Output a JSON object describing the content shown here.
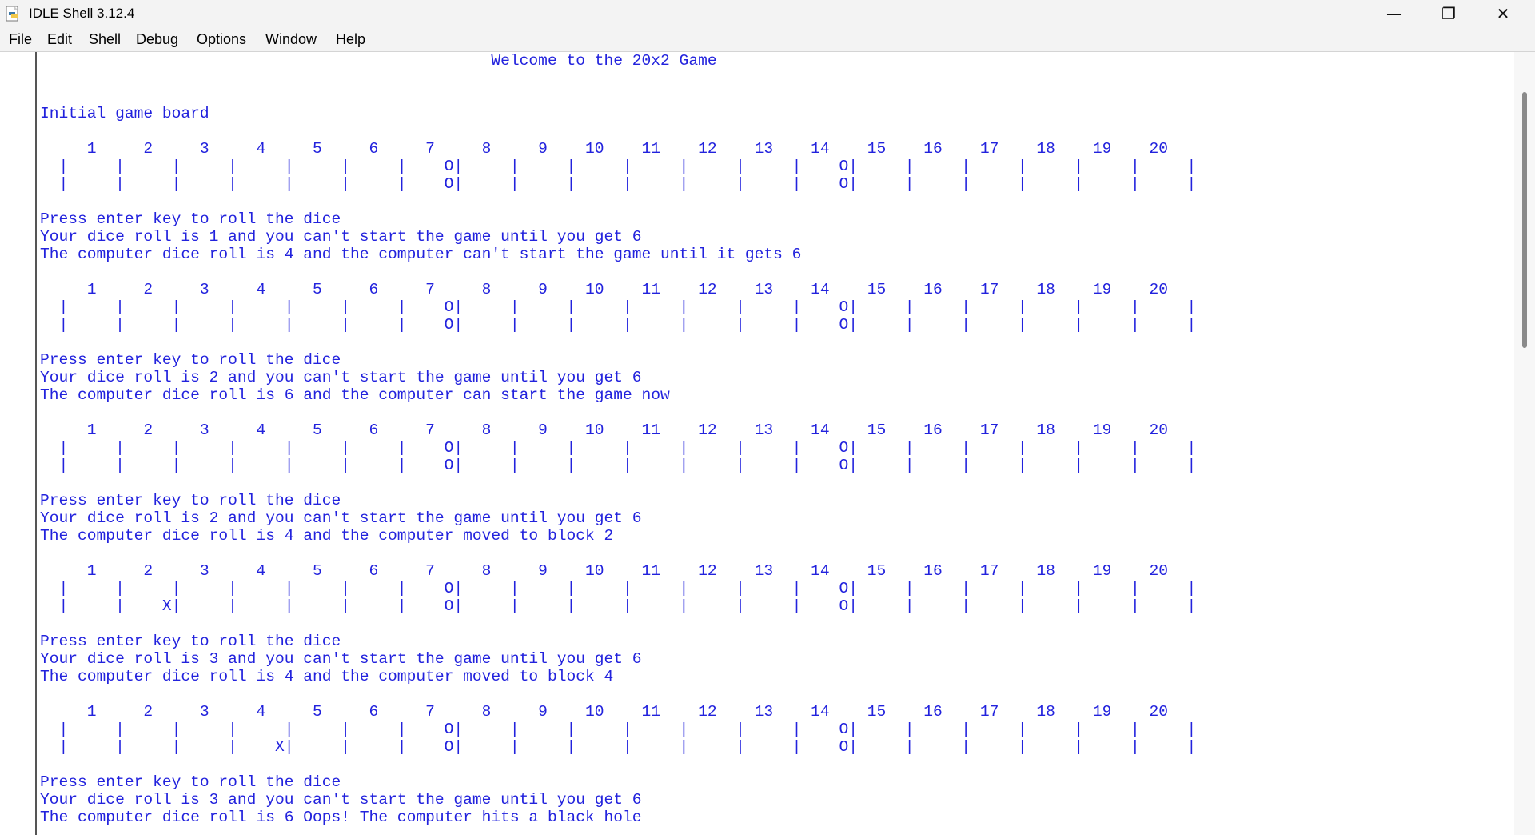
{
  "window": {
    "title": "IDLE Shell 3.12.4",
    "controls": {
      "minimize": "—",
      "maximize": "❐",
      "close": "✕"
    }
  },
  "menu": [
    "File",
    "Edit",
    "Shell",
    "Debug",
    "Options",
    "Window",
    "Help"
  ],
  "shell_lines": [
    "                                                Welcome to the 20x2 Game",
    "",
    "",
    "Initial game board",
    "",
    "     1     2     3     4     5     6     7     8     9    10    11    12    13    14    15    16    17    18    19    20",
    "  |     |     |     |     |     |     |    O|     |     |     |     |     |     |    O|     |     |     |     |     |     |",
    "  |     |     |     |     |     |     |    O|     |     |     |     |     |     |    O|     |     |     |     |     |     |",
    "",
    "Press enter key to roll the dice",
    "Your dice roll is 1 and you can't start the game until you get 6",
    "The computer dice roll is 4 and the computer can't start the game until it gets 6",
    "",
    "     1     2     3     4     5     6     7     8     9    10    11    12    13    14    15    16    17    18    19    20",
    "  |     |     |     |     |     |     |    O|     |     |     |     |     |     |    O|     |     |     |     |     |     |",
    "  |     |     |     |     |     |     |    O|     |     |     |     |     |     |    O|     |     |     |     |     |     |",
    "",
    "Press enter key to roll the dice",
    "Your dice roll is 2 and you can't start the game until you get 6",
    "The computer dice roll is 6 and the computer can start the game now",
    "",
    "     1     2     3     4     5     6     7     8     9    10    11    12    13    14    15    16    17    18    19    20",
    "  |     |     |     |     |     |     |    O|     |     |     |     |     |     |    O|     |     |     |     |     |     |",
    "  |     |     |     |     |     |     |    O|     |     |     |     |     |     |    O|     |     |     |     |     |     |",
    "",
    "Press enter key to roll the dice",
    "Your dice roll is 2 and you can't start the game until you get 6",
    "The computer dice roll is 4 and the computer moved to block 2",
    "",
    "     1     2     3     4     5     6     7     8     9    10    11    12    13    14    15    16    17    18    19    20",
    "  |     |     |     |     |     |     |    O|     |     |     |     |     |     |    O|     |     |     |     |     |     |",
    "  |     |    X|     |     |     |     |    O|     |     |     |     |     |     |    O|     |     |     |     |     |     |",
    "",
    "Press enter key to roll the dice",
    "Your dice roll is 3 and you can't start the game until you get 6",
    "The computer dice roll is 4 and the computer moved to block 4",
    "",
    "     1     2     3     4     5     6     7     8     9    10    11    12    13    14    15    16    17    18    19    20",
    "  |     |     |     |     |     |     |    O|     |     |     |     |     |     |    O|     |     |     |     |     |     |",
    "  |     |     |     |    X|     |     |    O|     |     |     |     |     |     |    O|     |     |     |     |     |     |",
    "",
    "Press enter key to roll the dice",
    "Your dice roll is 3 and you can't start the game until you get 6",
    "The computer dice roll is 6 Oops! The computer hits a black hole"
  ],
  "colors": {
    "shell_output": "#2222dd",
    "titlebar_bg": "#f3f3f3",
    "gutter_border": "#555555"
  }
}
